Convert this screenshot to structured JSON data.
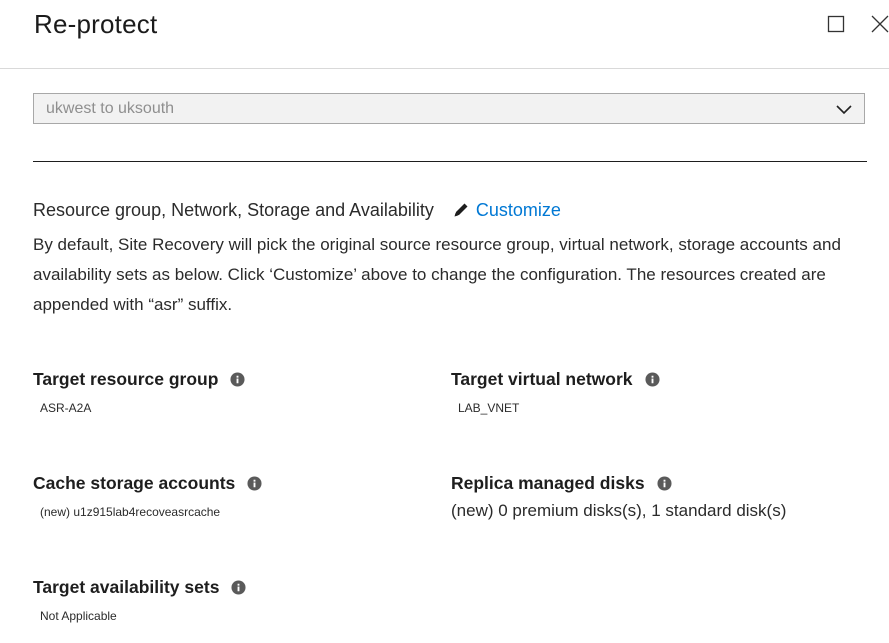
{
  "blade": {
    "title": "Re-protect"
  },
  "dropdown": {
    "value": "ukwest to uksouth"
  },
  "section": {
    "heading": "Resource group, Network, Storage and Availability",
    "customize_label": "Customize",
    "description": "By default, Site Recovery will pick the original source resource group, virtual network, storage accounts and availability sets as below. Click ‘Customize’ above to change the configuration. The resources created are appended with “asr” suffix."
  },
  "fields": {
    "target_resource_group": {
      "label": "Target resource group",
      "value": "ASR-A2A"
    },
    "target_virtual_network": {
      "label": "Target virtual network",
      "value": "LAB_VNET"
    },
    "cache_storage_accounts": {
      "label": "Cache storage accounts",
      "value": "(new) u1z915lab4recoveasrcache"
    },
    "replica_managed_disks": {
      "label": "Replica managed disks",
      "value": "(new) 0 premium disks(s), 1 standard disk(s)"
    },
    "target_availability_sets": {
      "label": "Target availability sets",
      "value": "Not Applicable"
    }
  },
  "colors": {
    "link": "#0078d4",
    "info_icon": "#5a5a5a"
  },
  "icons": [
    "maximize-icon",
    "close-icon",
    "chevron-down-icon",
    "pencil-icon",
    "info-icon"
  ]
}
